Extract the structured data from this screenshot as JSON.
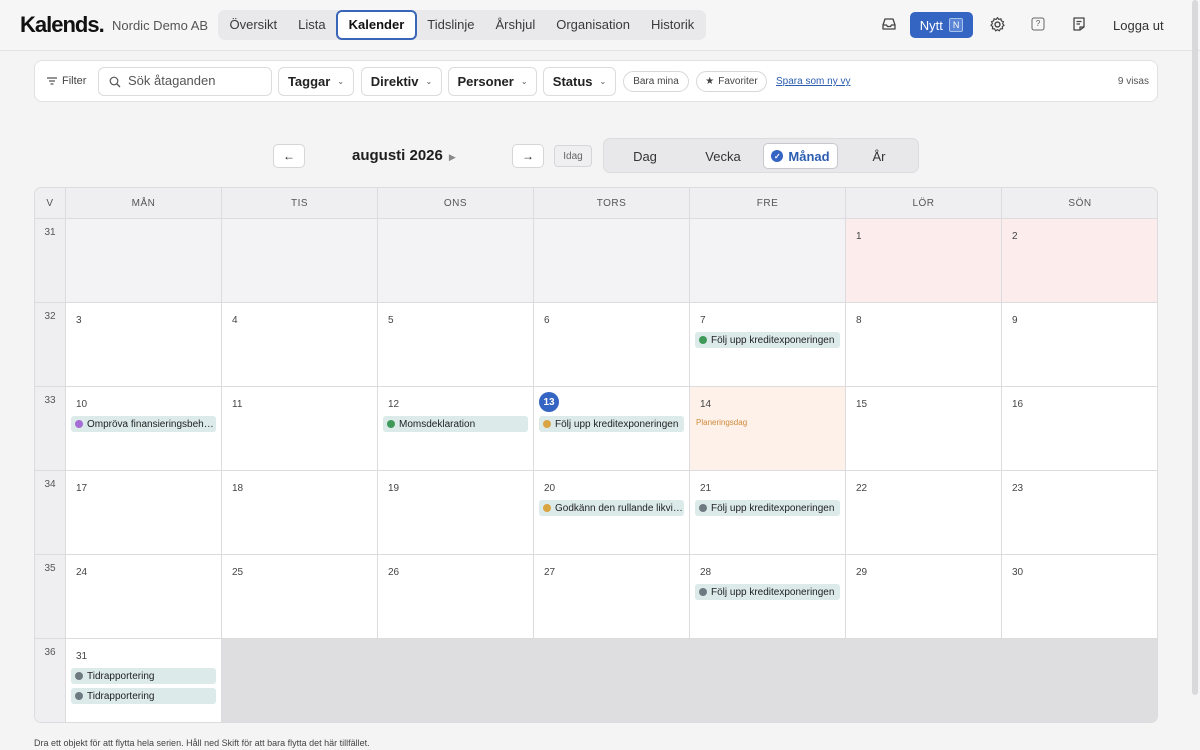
{
  "app": {
    "logo": "Kalends.",
    "org": "Nordic Demo AB",
    "nav": [
      "Översikt",
      "Lista",
      "Kalender",
      "Tidslinje",
      "Årshjul",
      "Organisation",
      "Historik"
    ],
    "active_nav": "Kalender",
    "new_label": "Nytt",
    "new_shortcut": "N",
    "help_icon_label": "?",
    "logout": "Logga ut",
    "icons": [
      "inbox-icon",
      "gear-icon",
      "help-icon",
      "notes-icon"
    ]
  },
  "filters": {
    "filter_label": "Filter",
    "search_placeholder": "Sök åtaganden",
    "dropdowns": [
      "Taggar",
      "Direktiv",
      "Personer",
      "Status"
    ],
    "only_mine": "Bara mina",
    "favorites": "Favoriter",
    "save_view": "Spara som ny vy",
    "count": "9 visas"
  },
  "calendar": {
    "prev": "←",
    "next": "→",
    "month_label": "augusti 2026",
    "today_label": "Idag",
    "views": [
      "Dag",
      "Vecka",
      "Månad",
      "År"
    ],
    "active_view": "Månad",
    "headers": [
      "V",
      "MÅN",
      "TIS",
      "ONS",
      "TORS",
      "FRE",
      "LÖR",
      "SÖN"
    ],
    "weeks": [
      {
        "week": "31",
        "days": [
          {
            "num": "",
            "type": "other"
          },
          {
            "num": "",
            "type": "other"
          },
          {
            "num": "",
            "type": "other"
          },
          {
            "num": "",
            "type": "other"
          },
          {
            "num": "",
            "type": "other"
          },
          {
            "num": "1",
            "type": "weekend"
          },
          {
            "num": "2",
            "type": "weekend"
          }
        ]
      },
      {
        "week": "32",
        "days": [
          {
            "num": "3"
          },
          {
            "num": "4"
          },
          {
            "num": "5"
          },
          {
            "num": "6"
          },
          {
            "num": "7",
            "events": [
              {
                "title": "Följ upp kreditexponeringen",
                "color": "#3f9a5a"
              }
            ]
          },
          {
            "num": "8"
          },
          {
            "num": "9"
          }
        ]
      },
      {
        "week": "33",
        "days": [
          {
            "num": "10",
            "events": [
              {
                "title": "Ompröva finansieringsbehovet",
                "color": "#a66dd4"
              }
            ]
          },
          {
            "num": "11"
          },
          {
            "num": "12",
            "events": [
              {
                "title": "Momsdeklaration",
                "color": "#3f9a5a"
              }
            ]
          },
          {
            "num": "13",
            "today": true,
            "events": [
              {
                "title": "Följ upp kreditexponeringen",
                "color": "#d9a441"
              }
            ]
          },
          {
            "num": "14",
            "type": "planning",
            "label": "Planeringsdag"
          },
          {
            "num": "15"
          },
          {
            "num": "16"
          }
        ]
      },
      {
        "week": "34",
        "days": [
          {
            "num": "17"
          },
          {
            "num": "18"
          },
          {
            "num": "19"
          },
          {
            "num": "20",
            "events": [
              {
                "title": "Godkänn den rullande likviditetsprognosen",
                "color": "#d9a441"
              }
            ]
          },
          {
            "num": "21",
            "events": [
              {
                "title": "Följ upp kreditexponeringen",
                "color": "#6f7a80"
              }
            ]
          },
          {
            "num": "22"
          },
          {
            "num": "23"
          }
        ]
      },
      {
        "week": "35",
        "days": [
          {
            "num": "24"
          },
          {
            "num": "25"
          },
          {
            "num": "26"
          },
          {
            "num": "27"
          },
          {
            "num": "28",
            "events": [
              {
                "title": "Följ upp kreditexponeringen",
                "color": "#6f7a80"
              }
            ]
          },
          {
            "num": "29"
          },
          {
            "num": "30"
          }
        ]
      },
      {
        "week": "36",
        "days": [
          {
            "num": "31",
            "events": [
              {
                "title": "Tidrapportering",
                "color": "#6f7a80"
              },
              {
                "title": "Tidrapportering",
                "color": "#6f7a80"
              }
            ]
          },
          {
            "num": "",
            "type": "empty"
          },
          {
            "num": "",
            "type": "empty"
          },
          {
            "num": "",
            "type": "empty"
          },
          {
            "num": "",
            "type": "empty"
          },
          {
            "num": "",
            "type": "empty"
          },
          {
            "num": "",
            "type": "empty"
          }
        ]
      }
    ]
  },
  "footer": "Dra ett objekt för att flytta hela serien. Håll ned Skift för att bara flytta det här tillfället."
}
